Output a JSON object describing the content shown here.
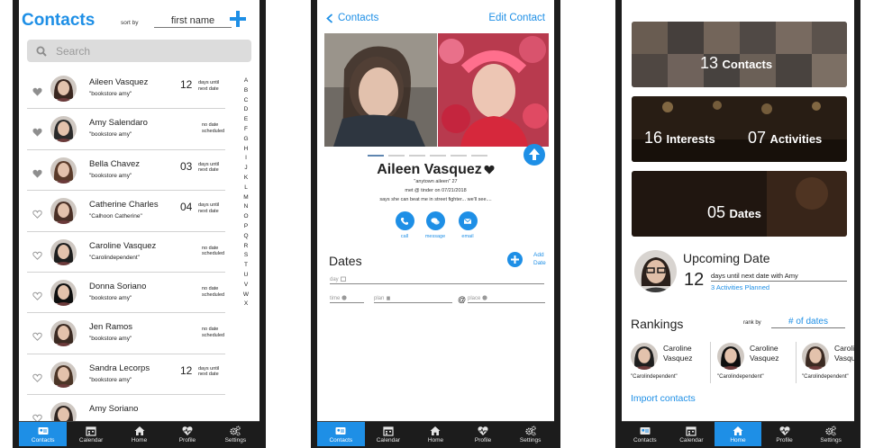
{
  "tabs": [
    {
      "label": "Contacts",
      "icon": "contacts-icon"
    },
    {
      "label": "Calendar",
      "icon": "calendar-icon"
    },
    {
      "label": "Home",
      "icon": "home-icon"
    },
    {
      "label": "Profile",
      "icon": "heart-pulse-icon"
    },
    {
      "label": "Settings",
      "icon": "gears-icon"
    }
  ],
  "contacts": {
    "title": "Contacts",
    "sort_label": "sort by",
    "sort_value": "first name",
    "search_placeholder": "Search",
    "rows": [
      {
        "name": "Aileen Vasquez",
        "nick": "\"bookstore amy\"",
        "days": "12",
        "days_line1": "days until",
        "days_line2": "next date",
        "nodate1": "",
        "nodate2": "",
        "favorite": true
      },
      {
        "name": "Amy Salendaro",
        "nick": "\"bookstore amy\"",
        "days": "",
        "days_line1": "",
        "days_line2": "",
        "nodate1": "no date",
        "nodate2": "scheduled",
        "favorite": true
      },
      {
        "name": "Bella Chavez",
        "nick": "\"bookstore amy\"",
        "days": "03",
        "days_line1": "days until",
        "days_line2": "next date",
        "nodate1": "",
        "nodate2": "",
        "favorite": true
      },
      {
        "name": "Catherine Charles",
        "nick": "\"Calhoon Catherine\"",
        "days": "04",
        "days_line1": "days until",
        "days_line2": "next date",
        "nodate1": "",
        "nodate2": "",
        "favorite": false
      },
      {
        "name": "Caroline Vasquez",
        "nick": "\"Carolindependent\"",
        "days": "",
        "days_line1": "",
        "days_line2": "",
        "nodate1": "no date",
        "nodate2": "scheduled",
        "favorite": false
      },
      {
        "name": "Donna Soriano",
        "nick": "\"bookstore amy\"",
        "days": "",
        "days_line1": "",
        "days_line2": "",
        "nodate1": "no date",
        "nodate2": "scheduled",
        "favorite": false
      },
      {
        "name": "Jen Ramos",
        "nick": "\"bookstore amy\"",
        "days": "",
        "days_line1": "",
        "days_line2": "",
        "nodate1": "no date",
        "nodate2": "scheduled",
        "favorite": false
      },
      {
        "name": "Sandra Lecorps",
        "nick": "\"bookstore amy\"",
        "days": "12",
        "days_line1": "days until",
        "days_line2": "next date",
        "nodate1": "",
        "nodate2": "",
        "favorite": false
      },
      {
        "name": "Amy Soriano",
        "nick": "",
        "days": "",
        "days_line1": "",
        "days_line2": "",
        "nodate1": "",
        "nodate2": "",
        "favorite": false
      }
    ],
    "alphabet": [
      "A",
      "B",
      "C",
      "D",
      "E",
      "F",
      "G",
      "H",
      "I",
      "J",
      "K",
      "L",
      "M",
      "N",
      "O",
      "P",
      "Q",
      "R",
      "S",
      "T",
      "U",
      "V",
      "W",
      "X"
    ]
  },
  "profile": {
    "back_label": "Contacts",
    "edit_label": "Edit Contact",
    "name": "Aileen Vasquez",
    "nick_line": "\"anytown aileen\" 27",
    "met_line": "met @ tinder   on 07/21/2018",
    "bio_line": "says she can beat me in street fighter... we'll see....",
    "actions": [
      {
        "label": "call",
        "icon": "phone-icon"
      },
      {
        "label": "message",
        "icon": "chat-icon"
      },
      {
        "label": "email",
        "icon": "mail-icon"
      }
    ],
    "dates_heading": "Dates",
    "add_date_line1": "Add",
    "add_date_line2": "Date",
    "fields": {
      "day": "day",
      "time": "time",
      "plan": "plan",
      "at": "@",
      "place": "place"
    }
  },
  "home": {
    "contacts_num": "13",
    "contacts_label": "Contacts",
    "interests_num": "16",
    "interests_label": "Interests",
    "activities_num": "07",
    "activities_label": "Activities",
    "dates_num": "05",
    "dates_label": "Dates",
    "upcoming_heading": "Upcoming Date",
    "upcoming_num": "12",
    "upcoming_text": "days until next date with Amy",
    "upcoming_plan": "3 Activities Planned",
    "rankings_heading": "Rankings",
    "rank_by_label": "rank by",
    "rank_by_value": "# of dates",
    "rankings": [
      {
        "name_line1": "Caroline",
        "name_line2": "Vasquez",
        "nick": "\"Carolindependent\""
      },
      {
        "name_line1": "Caroline",
        "name_line2": "Vasquez",
        "nick": "\"Carolindependent\""
      },
      {
        "name_line1": "Caroline",
        "name_line2": "Vasquez",
        "nick": "\"Carolindependent\""
      }
    ],
    "import_label": "Import contacts"
  },
  "colors": {
    "accent": "#1e8fe6",
    "bezel": "#1c1c1c",
    "divider": "#d2d2d2"
  }
}
